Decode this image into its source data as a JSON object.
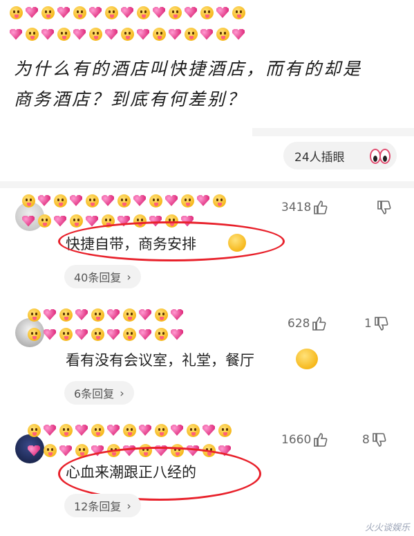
{
  "post": {
    "question_line1": "为什么有的酒店叫快捷酒店，而有的却是",
    "question_line2": "商务酒店？到底有何差别？",
    "watch_count": "24人插眼"
  },
  "comments": [
    {
      "text": "快捷自带，商务安排",
      "likes": "3418",
      "dislikes": "",
      "replies": "40条回复"
    },
    {
      "text": "看有没有会议室，礼堂，餐厅",
      "likes": "628",
      "dislikes": "1",
      "replies": "6条回复"
    },
    {
      "text": "心血来潮跟正八经的",
      "likes": "1660",
      "dislikes": "8",
      "replies": "12条回复"
    }
  ],
  "icons": {
    "like": "thumbs-up-icon",
    "dislike": "thumbs-down-icon",
    "watch": "eyes-icon",
    "reply": "chevron-right-icon"
  },
  "colors": {
    "highlight_circle": "#e8212b",
    "pill_bg": "#f2f2f2"
  },
  "watermark": "火火谈娱乐"
}
